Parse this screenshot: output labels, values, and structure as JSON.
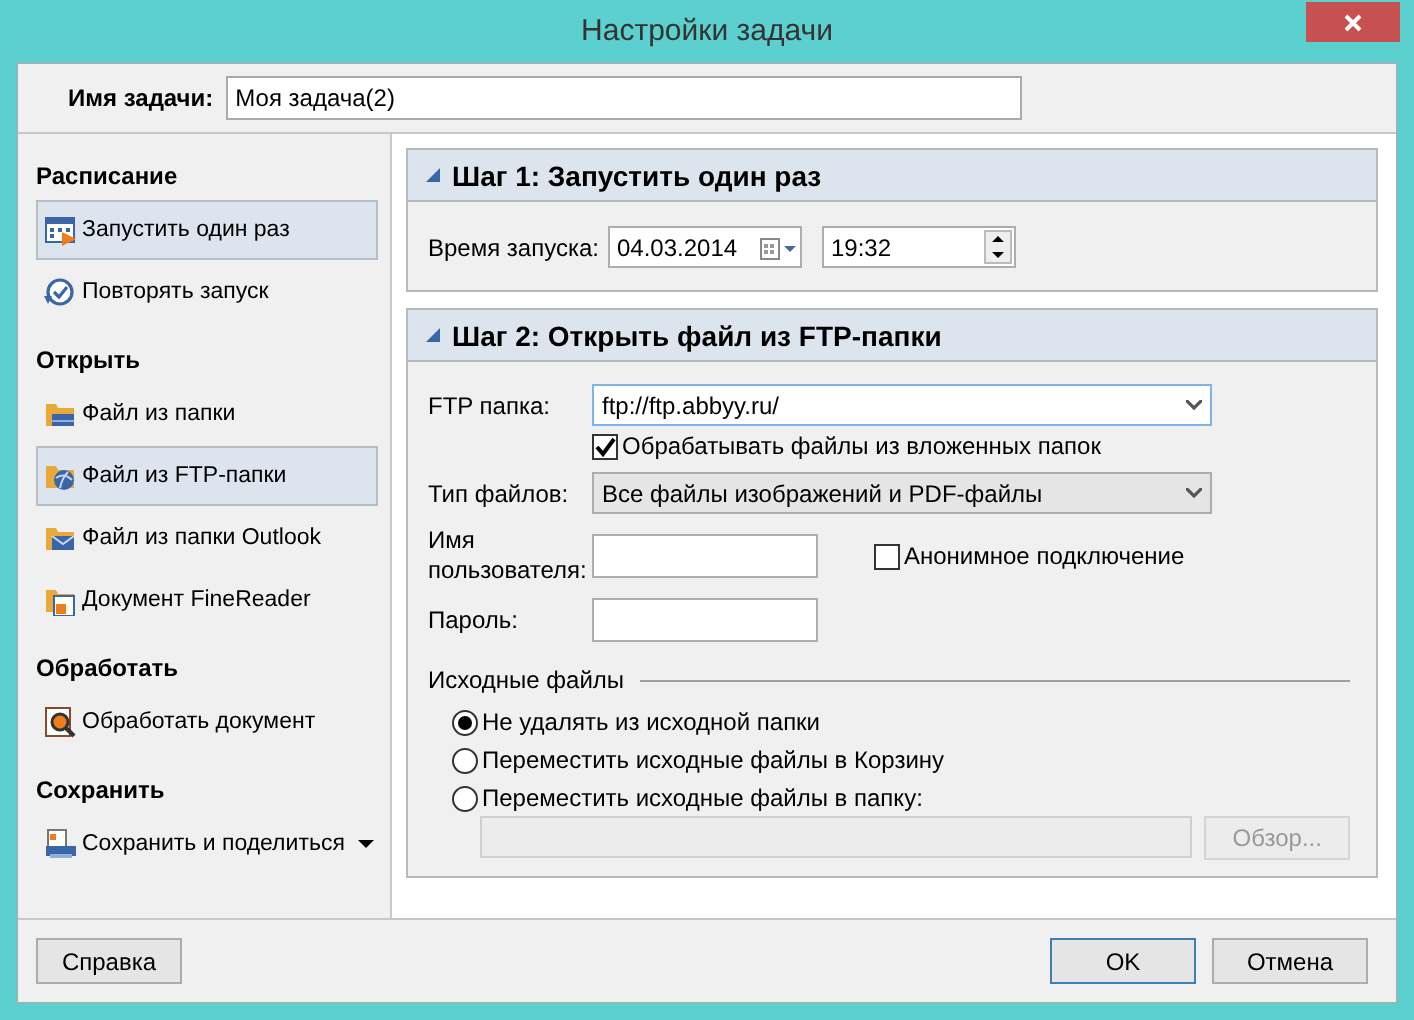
{
  "window": {
    "title": "Настройки задачи"
  },
  "task_name": {
    "label": "Имя задачи:",
    "value": "Моя задача(2)"
  },
  "sidebar": {
    "groups": [
      {
        "heading": "Расписание",
        "items": [
          {
            "label": "Запустить один раз",
            "kind": "calendar",
            "selected": true,
            "menu": false
          },
          {
            "label": "Повторять запуск",
            "kind": "repeat",
            "selected": false,
            "menu": false
          }
        ]
      },
      {
        "heading": "Открыть",
        "items": [
          {
            "label": "Файл из папки",
            "kind": "folder",
            "selected": false,
            "menu": false
          },
          {
            "label": "Файл из FTP-папки",
            "kind": "ftp",
            "selected": true,
            "menu": false
          },
          {
            "label": "Файл из папки Outlook",
            "kind": "mail",
            "selected": false,
            "menu": false
          },
          {
            "label": "Документ FineReader",
            "kind": "document",
            "selected": false,
            "menu": false
          }
        ]
      },
      {
        "heading": "Обработать",
        "items": [
          {
            "label": "Обработать документ",
            "kind": "process",
            "selected": false,
            "menu": false
          }
        ]
      },
      {
        "heading": "Сохранить",
        "items": [
          {
            "label": "Сохранить и поделиться",
            "kind": "save",
            "selected": false,
            "menu": true
          }
        ]
      }
    ]
  },
  "step1": {
    "title": "Шаг 1: Запустить один раз",
    "launch_label": "Время запуска:",
    "date": "04.03.2014",
    "time": "19:32"
  },
  "step2": {
    "title": "Шаг 2: Открыть файл из FTP-папки",
    "ftp_label": "FTP папка:",
    "ftp_value": "ftp://ftp.abbyy.ru/",
    "subfolders": {
      "label": "Обрабатывать файлы из вложенных папок",
      "checked": true
    },
    "file_type_label": "Тип файлов:",
    "file_type": "Все файлы изображений и PDF-файлы",
    "username_label": "Имя пользователя:",
    "anonymous": {
      "label": "Анонимное подключение",
      "checked": false
    },
    "password_label": "Пароль:",
    "source_files": {
      "heading": "Исходные файлы",
      "options": [
        {
          "label": "Не удалять из исходной папки",
          "selected": true
        },
        {
          "label": "Переместить исходные файлы в Корзину",
          "selected": false
        },
        {
          "label": "Переместить исходные файлы в папку:",
          "selected": false
        }
      ],
      "browse_button": {
        "label": "Обзор...",
        "disabled": true
      }
    }
  },
  "footer": {
    "help": "Справка",
    "ok": "OK",
    "cancel": "Отмена"
  }
}
